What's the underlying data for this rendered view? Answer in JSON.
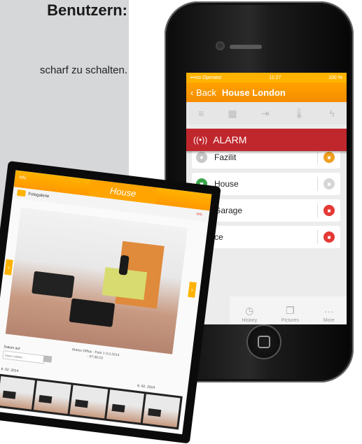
{
  "left_panel": {
    "heading": "Benutzern:",
    "text": "scharf zu schalten."
  },
  "phone": {
    "status": {
      "carrier": "•••oo Operator",
      "time": "11:27",
      "battery": "100 %"
    },
    "nav": {
      "back_label": "Back",
      "title": "House London"
    },
    "alarm_label": "ALARM",
    "rows": [
      {
        "label": "Fazilit",
        "status_color": "#c7c7c7",
        "lock_color": "#f0a020"
      },
      {
        "label": "House",
        "status_color": "#3aa64a",
        "lock_color": "#d6d6d6"
      },
      {
        "label": "Garage",
        "status_color": "#c7c7c7",
        "lock_color": "#e53935"
      },
      {
        "label": "ce",
        "status_color": "#c7c7c7",
        "lock_color": "#e53935"
      }
    ],
    "tabs": [
      {
        "label": "History",
        "icon": "clock-icon"
      },
      {
        "label": "Pictures",
        "icon": "pictures-icon"
      },
      {
        "label": "More",
        "icon": "more-icon"
      }
    ],
    "colors": {
      "accent": "#ff9f00",
      "alarm": "#c0272d"
    }
  },
  "tablet": {
    "top_left": "Info",
    "tab_title": "House",
    "gallery_title": "Fotogalerie",
    "gallery_right": "Info",
    "caption": "Status Office - Foto 1 0.0.2014 - 07:36:15",
    "date_label": "Datum auf",
    "date_placeholder": "Datum wählen",
    "strip_label_left": "6. 02. 2014",
    "strip_label_right": "6. 02. 2014"
  }
}
